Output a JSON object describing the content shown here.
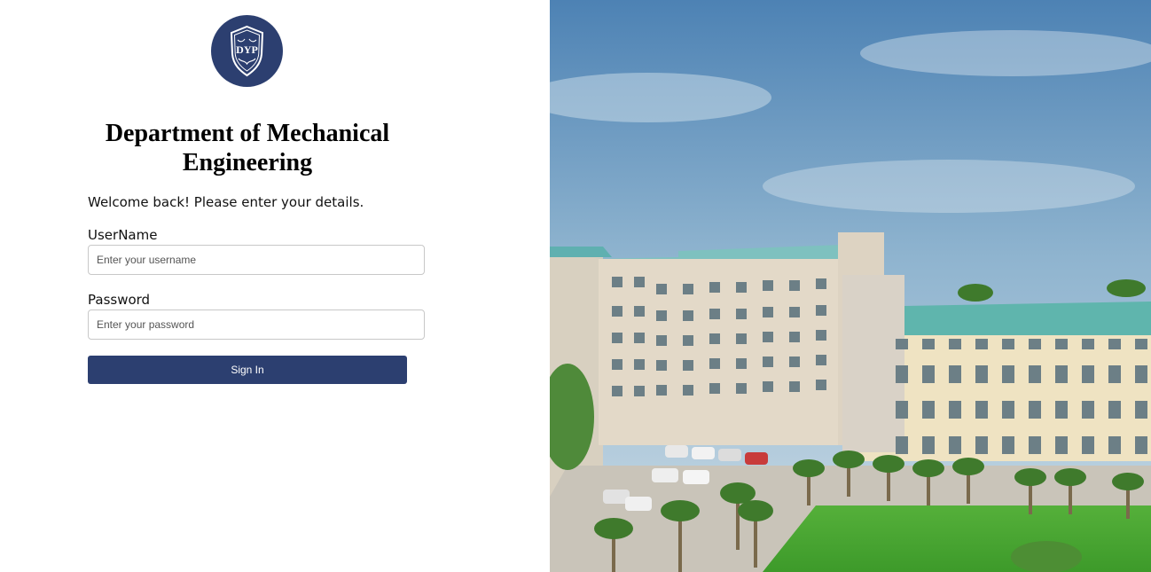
{
  "brand": {
    "logo_text": "DYP",
    "accent_color": "#2c3f70"
  },
  "login": {
    "title": "Department of Mechanical Engineering",
    "welcome": "Welcome back! Please enter your details.",
    "username_label": "UserName",
    "username_placeholder": "Enter your username",
    "username_value": "",
    "password_label": "Password",
    "password_placeholder": "Enter your password",
    "password_value": "",
    "signin_label": "Sign In"
  },
  "hero": {
    "image": "campus-building-photo"
  }
}
